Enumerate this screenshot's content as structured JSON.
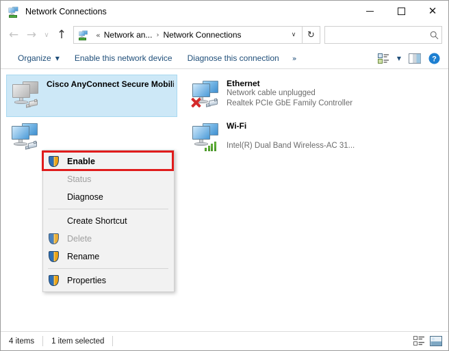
{
  "window": {
    "title": "Network Connections",
    "title_icon": "network-connections-icon",
    "minimize_label": "–",
    "maximize_label": "□",
    "close_label": "✕"
  },
  "navigation": {
    "back_label": "←",
    "forward_label": "→",
    "recent_label": "∨",
    "up_label": "↑",
    "refresh_label": "↻"
  },
  "address": {
    "icon": "network-icon",
    "overflow": "«",
    "crumb1": "Network an...",
    "separator": "›",
    "crumb2": "Network Connections",
    "dropdown": "∨"
  },
  "search": {
    "value": "",
    "placeholder": "",
    "icon_label": "⌕"
  },
  "toolbar": {
    "organize": "Organize",
    "organize_caret": "▼",
    "enable_device": "Enable this network device",
    "diagnose_connection": "Diagnose this connection",
    "more": "»",
    "view_caret": "▼"
  },
  "connections": [
    {
      "name": "Cisco AnyConnect Secure Mobility",
      "status": "",
      "adapter": "",
      "state": "disabled",
      "selected": true,
      "overlay": "rj45"
    },
    {
      "name": "",
      "status": "",
      "adapter": "",
      "state": "enabled",
      "selected": false,
      "overlay": "rj45"
    },
    {
      "name": "Ethernet",
      "status": "Network cable unplugged",
      "adapter": "Realtek PCIe GbE Family Controller",
      "state": "unplugged",
      "selected": false,
      "overlay": "rj45-x"
    },
    {
      "name": "Wi-Fi",
      "status": "",
      "adapter": "Intel(R) Dual Band Wireless-AC 31...",
      "state": "connected",
      "selected": false,
      "overlay": "wifi-bars"
    }
  ],
  "context_menu": {
    "items": [
      {
        "label": "Enable",
        "disabled": false,
        "bold": true,
        "shield": true
      },
      {
        "label": "Status",
        "disabled": true,
        "bold": false,
        "shield": false
      },
      {
        "label": "Diagnose",
        "disabled": false,
        "bold": false,
        "shield": false
      },
      {
        "separator": true
      },
      {
        "label": "Create Shortcut",
        "disabled": false,
        "bold": false,
        "shield": false
      },
      {
        "label": "Delete",
        "disabled": true,
        "bold": false,
        "shield": true
      },
      {
        "label": "Rename",
        "disabled": false,
        "bold": false,
        "shield": true
      },
      {
        "separator": true
      },
      {
        "label": "Properties",
        "disabled": false,
        "bold": false,
        "shield": true
      }
    ],
    "highlight_color": "#e01b1b",
    "highlighted_item": "Enable"
  },
  "status_bar": {
    "item_count": "4 items",
    "selection": "1 item selected",
    "details_view_icon": "details-view-icon",
    "tiles_view_icon": "tiles-view-icon"
  },
  "colors": {
    "link": "#1f4e79",
    "selection_bg": "#cde8f7",
    "selection_border": "#a8d8f0",
    "highlight": "#e01b1b"
  }
}
